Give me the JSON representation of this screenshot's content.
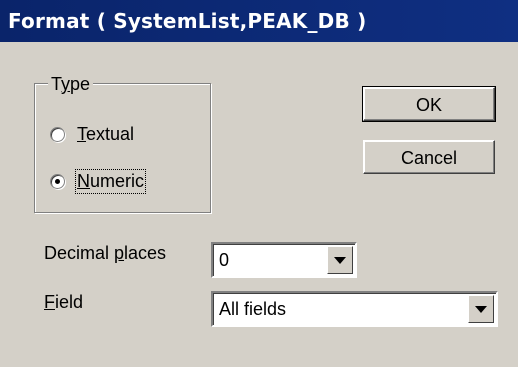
{
  "window": {
    "title": "Format ( SystemList,PEAK_DB )"
  },
  "type_group": {
    "label_mnemonic": "y",
    "label_pre": "T",
    "label_post": "pe",
    "options": [
      {
        "mnemonic": "T",
        "rest": "extual",
        "selected": false
      },
      {
        "mnemonic": "N",
        "rest": "umeric",
        "selected": true
      }
    ]
  },
  "buttons": {
    "ok": "OK",
    "cancel": "Cancel"
  },
  "decimal_places": {
    "label_pre": "Decimal ",
    "label_mnemonic": "p",
    "label_post": "laces",
    "value": "0"
  },
  "field": {
    "label_mnemonic": "F",
    "label_post": "ield",
    "value": "All fields"
  },
  "icons": {
    "dropdown": "chevron-down-icon",
    "radio": "radio-icon"
  }
}
